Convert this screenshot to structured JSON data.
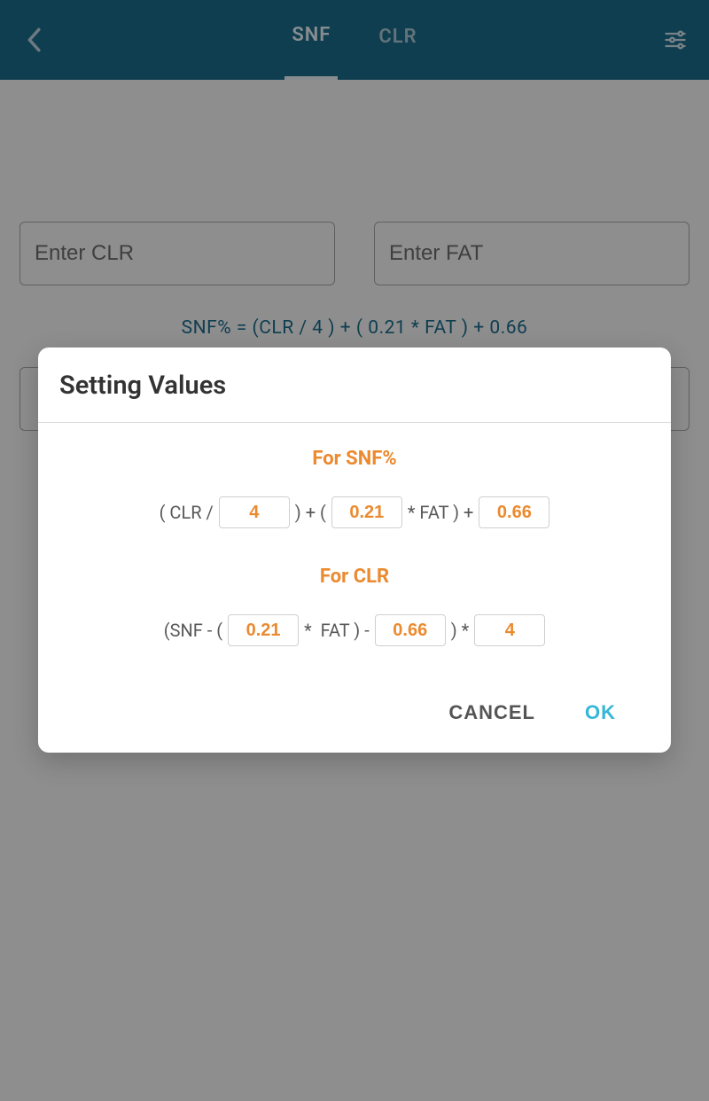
{
  "header": {
    "tabs": {
      "snf": "SNF",
      "clr": "CLR"
    }
  },
  "main": {
    "clr_placeholder": "Enter CLR",
    "fat_placeholder": "Enter FAT",
    "formula": "SNF% = (CLR / 4 ) + ( 0.21 * FAT ) + 0.66"
  },
  "dialog": {
    "title": "Setting Values",
    "snf_section": "For SNF%",
    "clr_section": "For CLR",
    "snf_formula": {
      "t1": "( CLR /",
      "v1": "4",
      "t2": ") + (",
      "v2": "0.21",
      "t3": "* FAT ) +",
      "v3": "0.66"
    },
    "clr_formula": {
      "t1": "(SNF - (",
      "v1": "0.21",
      "t2": "*  FAT ) -",
      "v2": "0.66",
      "t3": ") *",
      "v3": "4"
    },
    "cancel": "CANCEL",
    "ok": "OK"
  }
}
